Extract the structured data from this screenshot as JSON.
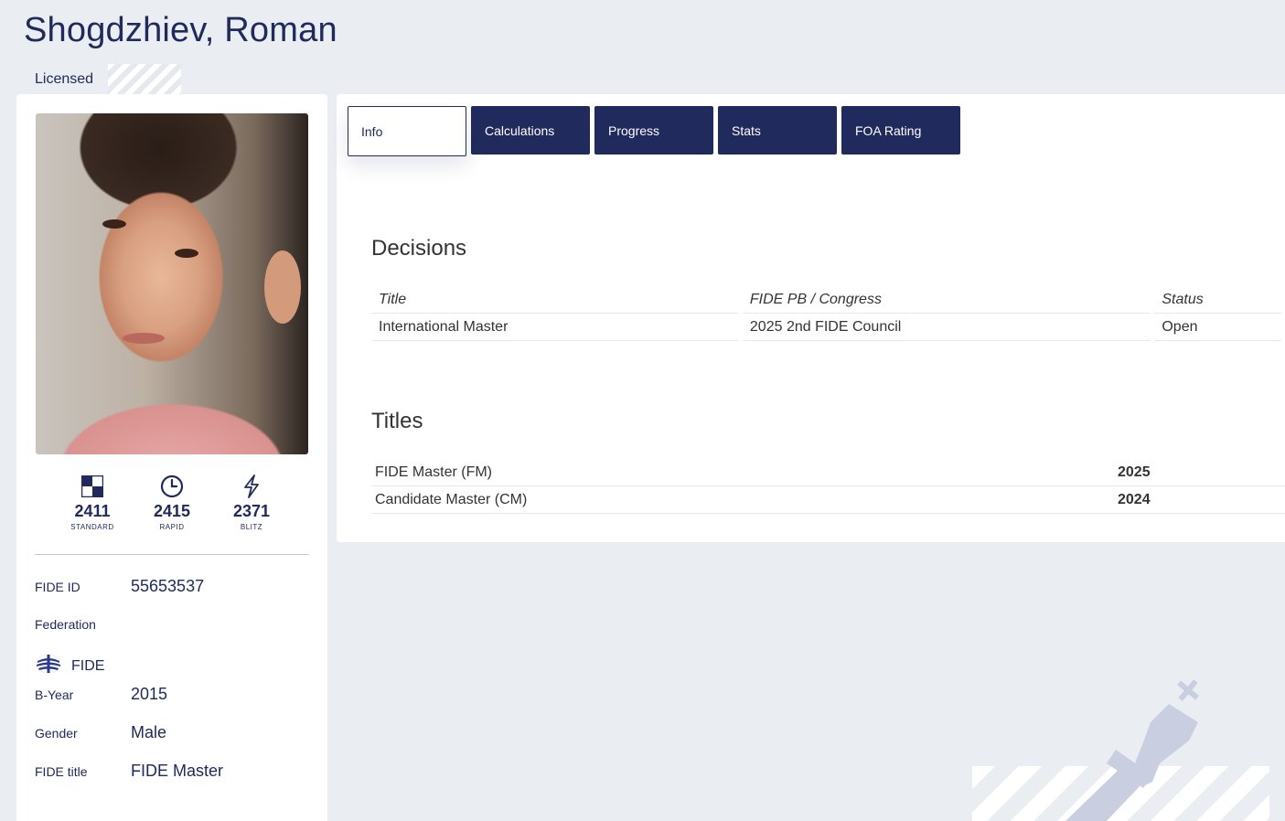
{
  "player": {
    "name": "Shogdzhiev, Roman",
    "license": "Licensed"
  },
  "ratings": [
    {
      "icon": "standard-board-icon",
      "value": "2411",
      "type": "STANDARD"
    },
    {
      "icon": "clock-icon",
      "value": "2415",
      "type": "RAPID"
    },
    {
      "icon": "lightning-icon",
      "value": "2371",
      "type": "BLITZ"
    }
  ],
  "info": {
    "fide_id_label": "FIDE ID",
    "fide_id": "55653537",
    "federation_label": "Federation",
    "federation": "FIDE",
    "byear_label": "B-Year",
    "byear": "2015",
    "gender_label": "Gender",
    "gender": "Male",
    "title_label": "FIDE title",
    "title": "FIDE Master"
  },
  "tabs": [
    "Info",
    "Calculations",
    "Progress",
    "Stats",
    "FOA Rating"
  ],
  "decisions": {
    "heading": "Decisions",
    "columns": [
      "Title",
      "FIDE PB / Congress",
      "Status"
    ],
    "rows": [
      [
        "International Master",
        "2025 2nd FIDE Council",
        "Open"
      ]
    ]
  },
  "titles": {
    "heading": "Titles",
    "rows": [
      [
        "FIDE Master (FM)",
        "2025"
      ],
      [
        "Candidate Master (CM)",
        "2024"
      ]
    ]
  },
  "colors": {
    "brand_navy": "#212a5c",
    "page_bg": "#eaedf2",
    "card_bg": "#ffffff",
    "decor_king": "#c9cfe0"
  }
}
